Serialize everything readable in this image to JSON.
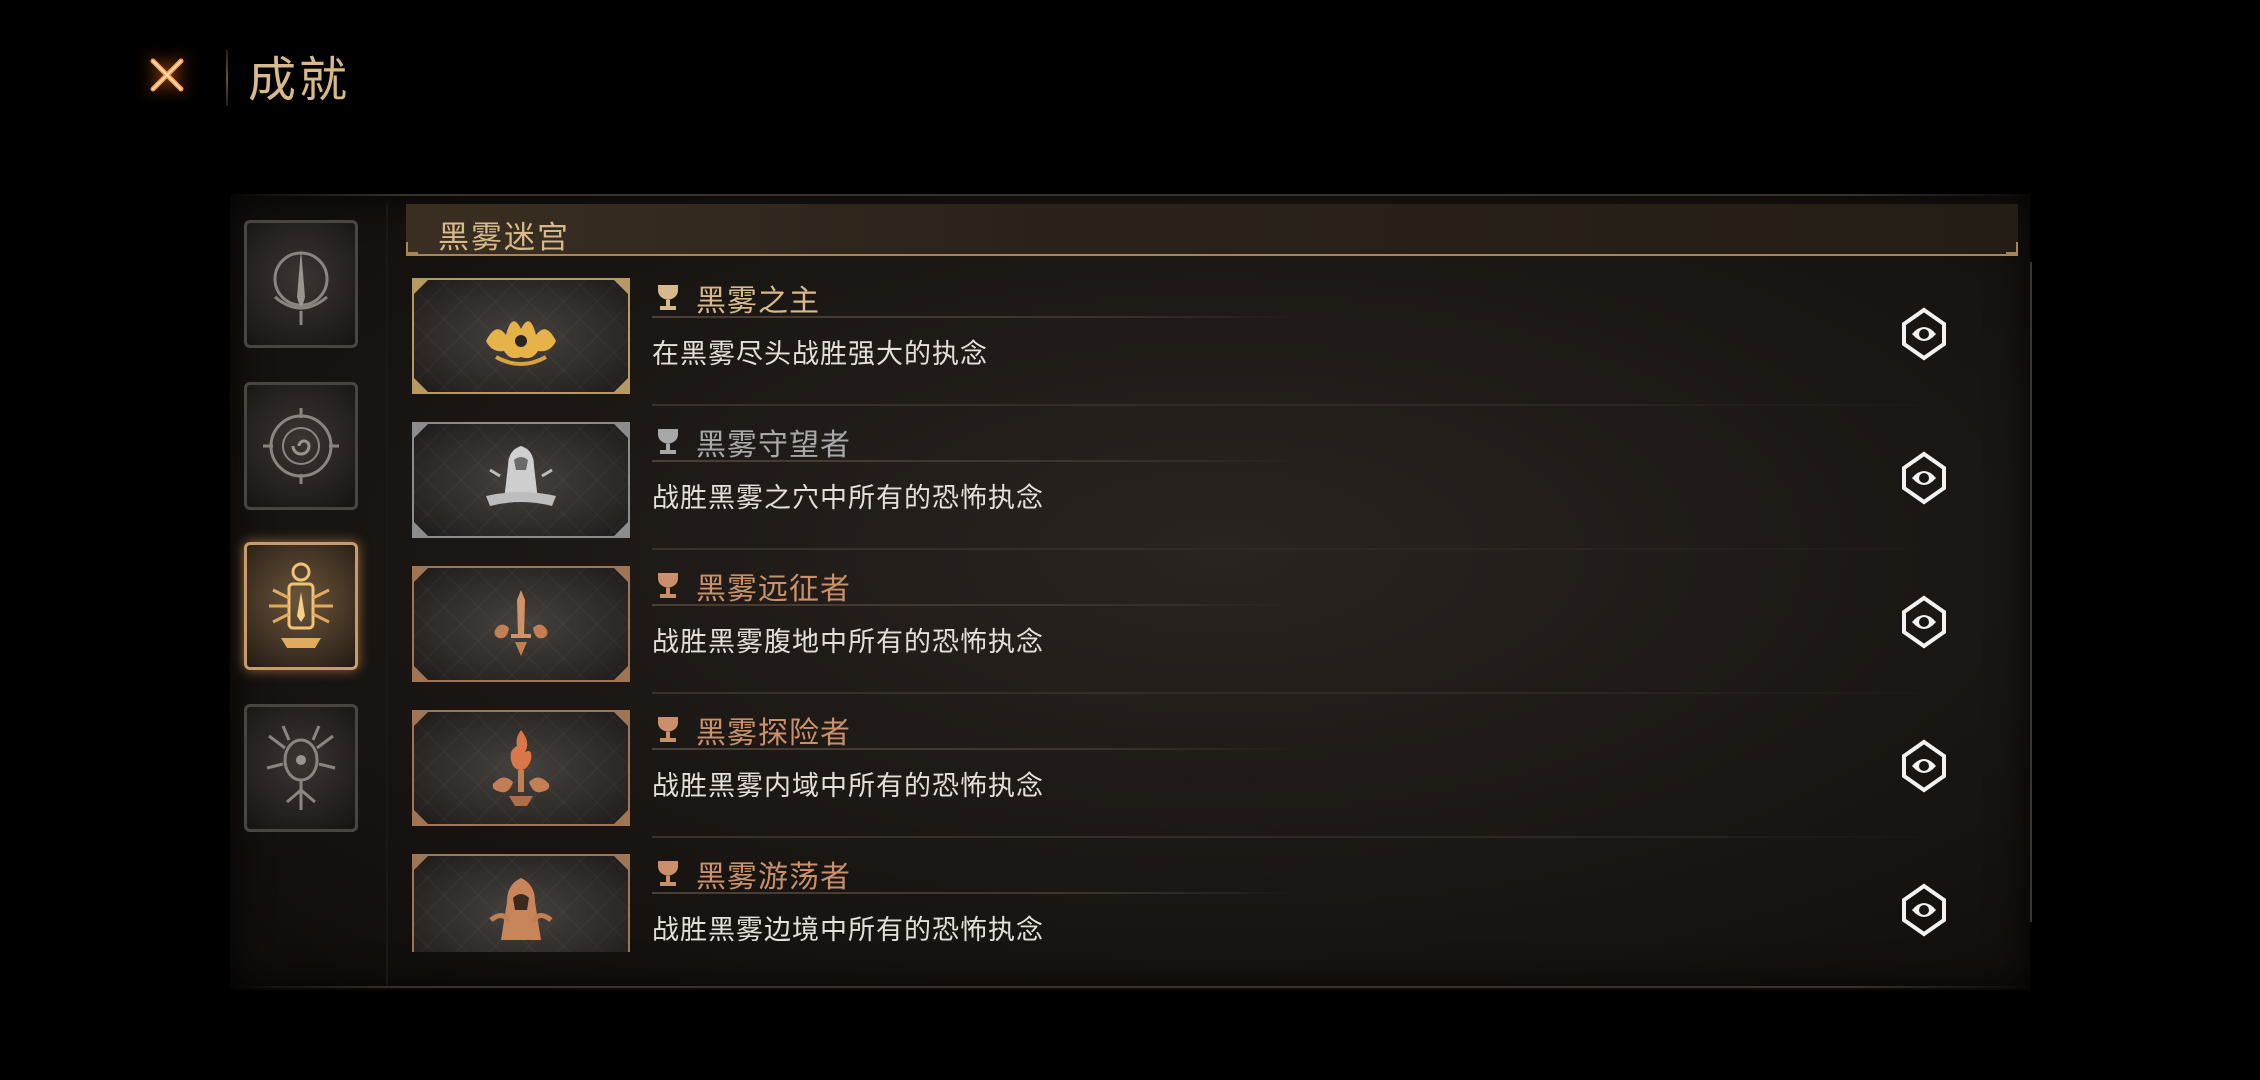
{
  "header": {
    "title": "成就",
    "close_icon": "close-x-icon"
  },
  "colors": {
    "gold": "#d7b98c",
    "silver": "#a8a8a8",
    "bronze": "#c9906a",
    "glow": "#ff6e1e"
  },
  "sidebar": {
    "categories": [
      {
        "icon": "horn-sigil-icon",
        "active": false
      },
      {
        "icon": "spiral-eye-sigil-icon",
        "active": false
      },
      {
        "icon": "lantern-sigil-icon",
        "active": true
      },
      {
        "icon": "tree-sigil-icon",
        "active": false
      }
    ]
  },
  "section": {
    "title": "黑雾迷宫"
  },
  "achievements": [
    {
      "name": "黑雾之主",
      "description": "在黑雾尽头战胜强大的执念",
      "tier": "gold",
      "icon": "crown-flame-icon"
    },
    {
      "name": "黑雾守望者",
      "description": "战胜黑雾之穴中所有的恐怖执念",
      "tier": "silver",
      "icon": "hooded-figure-icon"
    },
    {
      "name": "黑雾远征者",
      "description": "战胜黑雾腹地中所有的恐怖执念",
      "tier": "bronze",
      "icon": "sword-cloud-icon"
    },
    {
      "name": "黑雾探险者",
      "description": "战胜黑雾内域中所有的恐怖执念",
      "tier": "bronze",
      "icon": "torch-cloud-icon"
    },
    {
      "name": "黑雾游荡者",
      "description": "战胜黑雾边境中所有的恐怖执念",
      "tier": "bronze",
      "icon": "cloak-figure-icon"
    }
  ]
}
